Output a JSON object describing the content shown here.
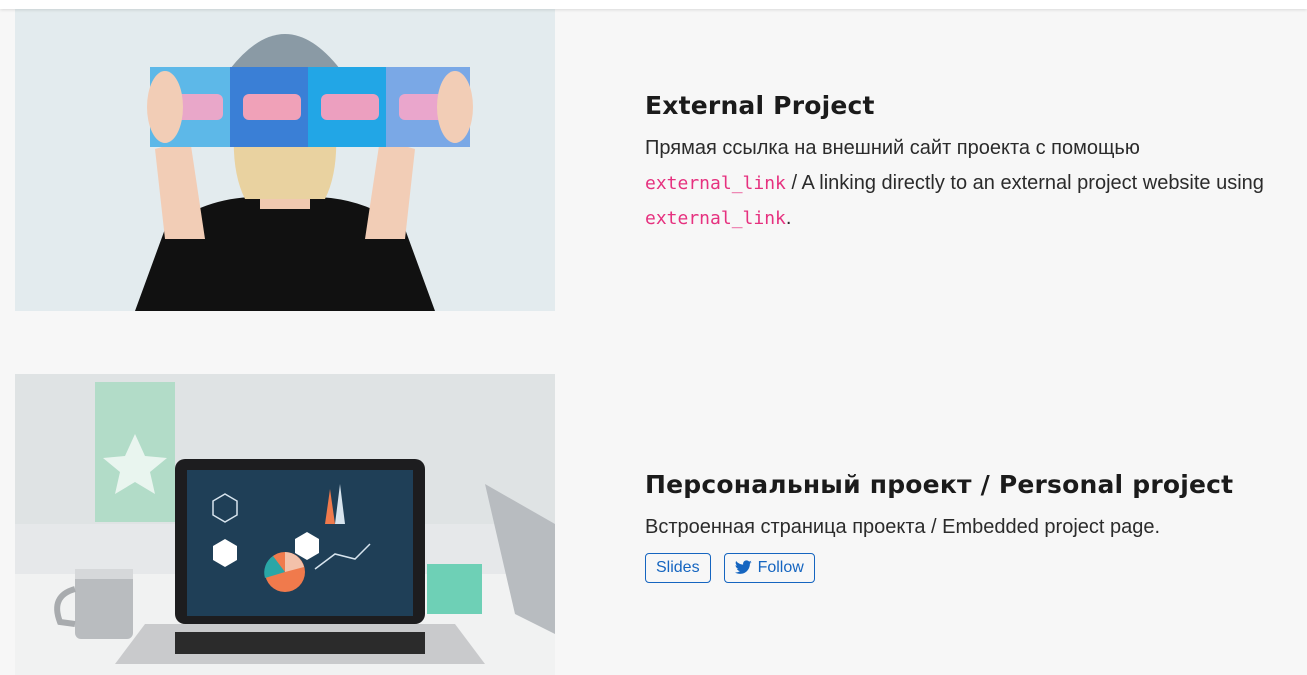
{
  "projects": [
    {
      "title": "External Project",
      "summary_part1": "Прямая ссылка на внешний сайт проекта с помощью ",
      "summary_code1": "external_link",
      "summary_part2": " / A linking directly to an external project website using ",
      "summary_code2": "external_link",
      "summary_part3": "."
    },
    {
      "title": "Персональный проект / Personal project",
      "summary": "Встроенная страница проекта / Embedded project page.",
      "buttons": {
        "slides_label": "Slides",
        "follow_label": "Follow",
        "follow_icon": "twitter-icon"
      }
    }
  ],
  "colors": {
    "background": "#f7f7f7",
    "code": "#e6317f",
    "button": "#1565c0"
  }
}
